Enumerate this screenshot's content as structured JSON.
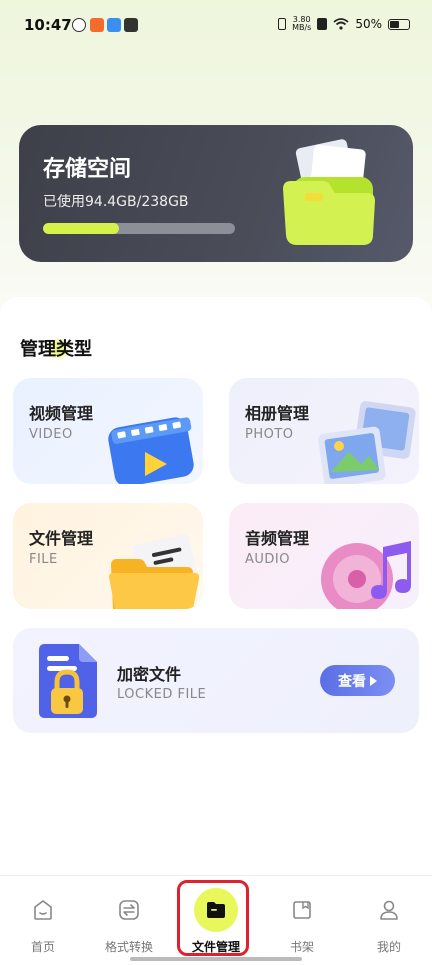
{
  "status_bar": {
    "time": "10:47",
    "net_speed_value": "3.80",
    "net_speed_unit": "MB/s",
    "battery": "50%"
  },
  "storage": {
    "title": "存储空间",
    "used_text": "已使用94.4GB/238GB",
    "used_fraction": 0.397,
    "fill_color": "#d6f24a"
  },
  "section": {
    "title": "管理类型"
  },
  "cards": {
    "video": {
      "title": "视频管理",
      "subtitle": "VIDEO",
      "icon": "video-play-icon"
    },
    "photo": {
      "title": "相册管理",
      "subtitle": "PHOTO",
      "icon": "photo-stack-icon"
    },
    "file": {
      "title": "文件管理",
      "subtitle": "FILE",
      "icon": "open-folder-icon"
    },
    "audio": {
      "title": "音频管理",
      "subtitle": "AUDIO",
      "icon": "music-disc-icon"
    },
    "locked": {
      "title": "加密文件",
      "subtitle": "LOCKED FILE",
      "button": "查看",
      "icon": "locked-document-icon"
    }
  },
  "nav": {
    "items": [
      {
        "label": "首页",
        "icon": "home-icon"
      },
      {
        "label": "格式转换",
        "icon": "convert-icon"
      },
      {
        "label": "文件管理",
        "icon": "folder-icon",
        "active": true
      },
      {
        "label": "书架",
        "icon": "bookshelf-icon"
      },
      {
        "label": "我的",
        "icon": "profile-icon"
      }
    ]
  },
  "colors": {
    "accent": "#e8f75a",
    "button": "#5b6fe6",
    "highlight": "#e0202c"
  }
}
